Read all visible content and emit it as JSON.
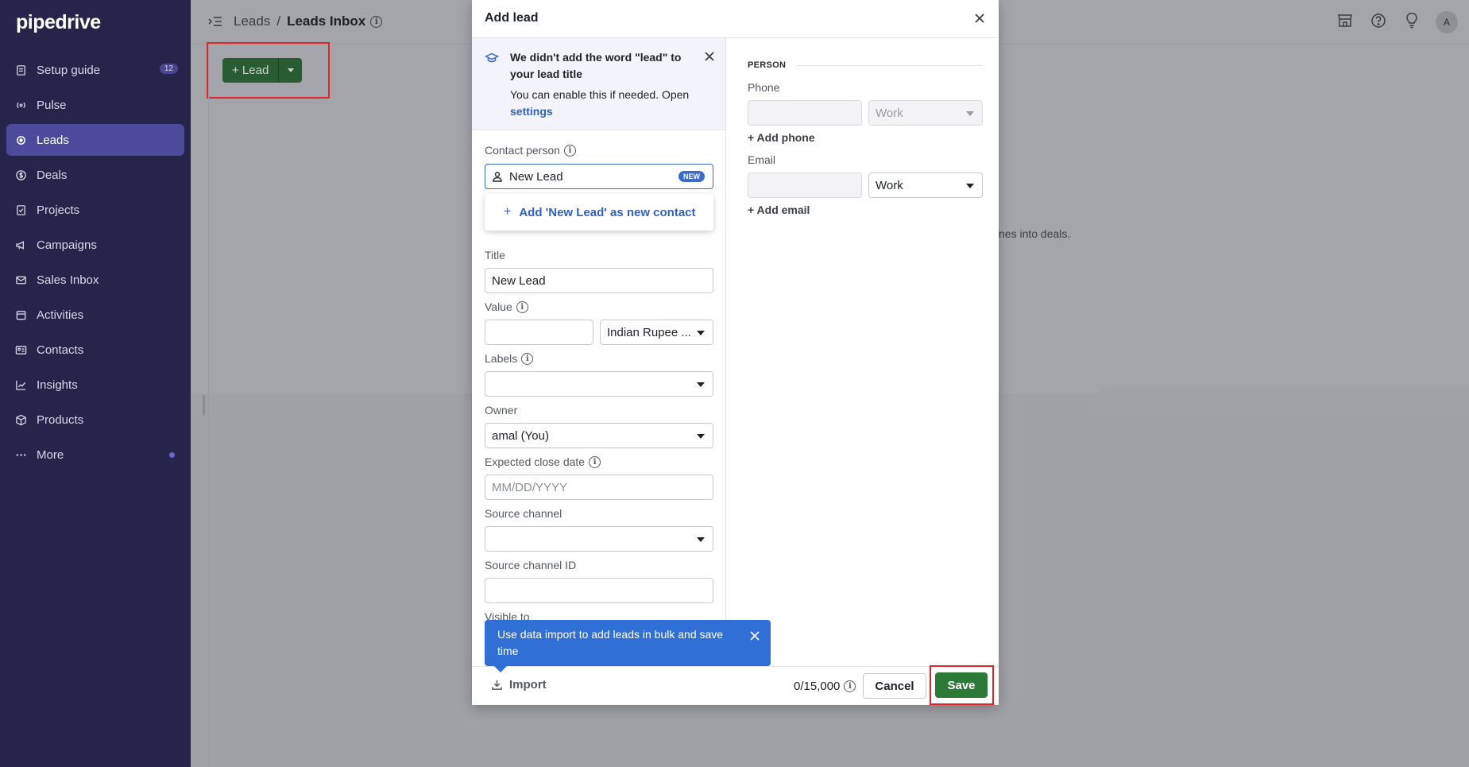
{
  "app": {
    "logo": "pipedrive"
  },
  "sidebar": {
    "items": [
      {
        "label": "Setup guide",
        "icon": "clipboard-icon",
        "badge": "12"
      },
      {
        "label": "Pulse",
        "icon": "pulse-icon"
      },
      {
        "label": "Leads",
        "icon": "target-icon",
        "active": true
      },
      {
        "label": "Deals",
        "icon": "dollar-icon"
      },
      {
        "label": "Projects",
        "icon": "checklist-icon"
      },
      {
        "label": "Campaigns",
        "icon": "megaphone-icon"
      },
      {
        "label": "Sales Inbox",
        "icon": "mail-icon"
      },
      {
        "label": "Activities",
        "icon": "calendar-icon"
      },
      {
        "label": "Contacts",
        "icon": "contact-card-icon"
      },
      {
        "label": "Insights",
        "icon": "chart-icon"
      },
      {
        "label": "Products",
        "icon": "box-icon"
      },
      {
        "label": "More",
        "icon": "more-icon"
      }
    ]
  },
  "header": {
    "crumb1": "Leads",
    "separator": "/",
    "crumb2": "Leads Inbox"
  },
  "toolbar": {
    "lead_button": "+ Lead"
  },
  "background": {
    "hint_text": "nes into deals."
  },
  "modal": {
    "title": "Add lead",
    "notice": {
      "title": "We didn't add the word \"lead\" to your lead title",
      "body": "You can enable this if needed. Open",
      "link": "settings"
    },
    "fields": {
      "contact_person": {
        "label": "Contact person",
        "value": "New Lead",
        "badge": "NEW"
      },
      "suggest": "Add 'New Lead' as new contact",
      "title": {
        "label": "Title",
        "value": "New Lead"
      },
      "value": {
        "label": "Value",
        "amount": "",
        "currency": "Indian Rupee ..."
      },
      "labels": {
        "label": "Labels",
        "value": ""
      },
      "owner": {
        "label": "Owner",
        "value": "amal (You)"
      },
      "close_date": {
        "label": "Expected close date",
        "placeholder": "MM/DD/YYYY"
      },
      "source_channel": {
        "label": "Source channel",
        "value": ""
      },
      "source_channel_id": {
        "label": "Source channel ID",
        "value": ""
      },
      "visible_to": {
        "label": "Visible to"
      }
    },
    "person": {
      "section": "PERSON",
      "phone_label": "Phone",
      "phone_type": "Work",
      "add_phone": "+ Add phone",
      "email_label": "Email",
      "email_type": "Work",
      "add_email": "+ Add email"
    },
    "tooltip": "Use data import to add leads in bulk and save time",
    "footer": {
      "import": "Import",
      "counter": "0/15,000",
      "cancel": "Cancel",
      "save": "Save"
    }
  }
}
